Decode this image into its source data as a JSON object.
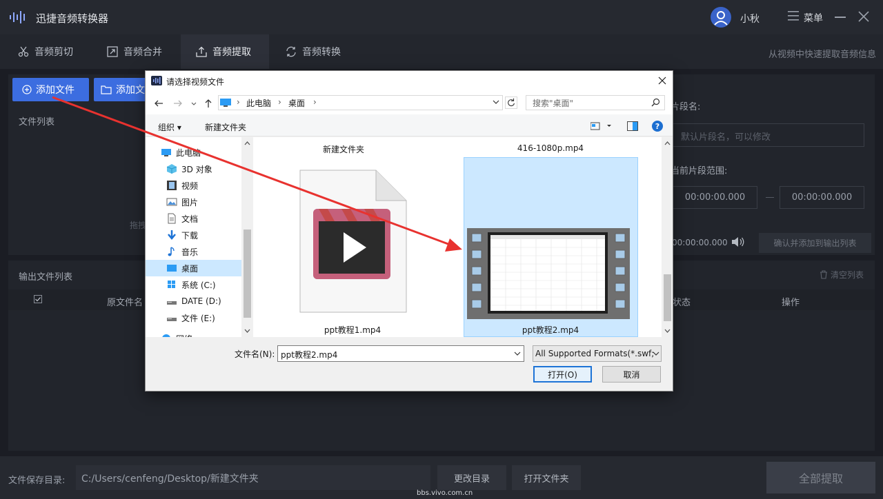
{
  "app": {
    "title": "迅捷音频转换器",
    "user_name": "小秋",
    "menu_label": "菜单",
    "accent": "#3c6de0"
  },
  "tabs": [
    {
      "label": "音频剪切",
      "icon": "scissors-icon"
    },
    {
      "label": "音频合并",
      "icon": "merge-icon"
    },
    {
      "label": "音频提取",
      "icon": "extract-icon",
      "active": true
    },
    {
      "label": "音频转换",
      "icon": "convert-icon"
    }
  ],
  "tab_hint": "从视频中快速提取音频信息",
  "toolbar": {
    "add_file": "添加文件",
    "add_folder": "添加文件夹"
  },
  "file_list": {
    "label": "文件列表",
    "drag_hint": "拖拽"
  },
  "segment": {
    "name_label": "片段名:",
    "name_placeholder": "默认片段名，可以修改",
    "range_label": "当前片段范围:",
    "start": "00:00:00.000",
    "end": "00:00:00.000",
    "play_time": "00:00:00.000",
    "confirm_button": "确认并添加到输出列表"
  },
  "output": {
    "label": "输出文件列表",
    "clear": "清空列表",
    "columns": [
      "原文件名",
      "状态",
      "操作"
    ]
  },
  "bottom": {
    "save_label": "文件保存目录:",
    "save_path": "C:/Users/cenfeng/Desktop/新建文件夹",
    "change_dir": "更改目录",
    "open_folder": "打开文件夹",
    "extract_all": "全部提取"
  },
  "watermark": "bbs.vivo.com.cn",
  "dialog": {
    "title": "请选择视频文件",
    "breadcrumb": [
      "此电脑",
      "桌面"
    ],
    "search_placeholder": "搜索\"桌面\"",
    "organize": "组织",
    "new_folder": "新建文件夹",
    "nav_items": [
      {
        "label": "此电脑",
        "icon": "computer-icon"
      },
      {
        "label": "3D 对象",
        "icon": "cube-icon"
      },
      {
        "label": "视频",
        "icon": "video-icon"
      },
      {
        "label": "图片",
        "icon": "picture-icon"
      },
      {
        "label": "文档",
        "icon": "document-icon"
      },
      {
        "label": "下载",
        "icon": "download-icon"
      },
      {
        "label": "音乐",
        "icon": "music-icon"
      },
      {
        "label": "桌面",
        "icon": "desktop-icon",
        "selected": true
      },
      {
        "label": "系统 (C:)",
        "icon": "drive-icon"
      },
      {
        "label": "DATE (D:)",
        "icon": "drive-icon"
      },
      {
        "label": "文件 (E:)",
        "icon": "drive-icon"
      },
      {
        "label": "网络",
        "icon": "network-icon"
      }
    ],
    "files": [
      {
        "name": "新建文件夹"
      },
      {
        "name": "416-1080p.mp4"
      },
      {
        "name": "ppt教程1.mp4"
      },
      {
        "name": "ppt教程2.mp4",
        "selected": true
      }
    ],
    "filename_label": "文件名(N):",
    "filename_value": "ppt教程2.mp4",
    "filter_value": "All Supported Formats(*.swf;",
    "open_button": "打开(O)",
    "cancel_button": "取消"
  },
  "annotation_color": "#e8322f"
}
